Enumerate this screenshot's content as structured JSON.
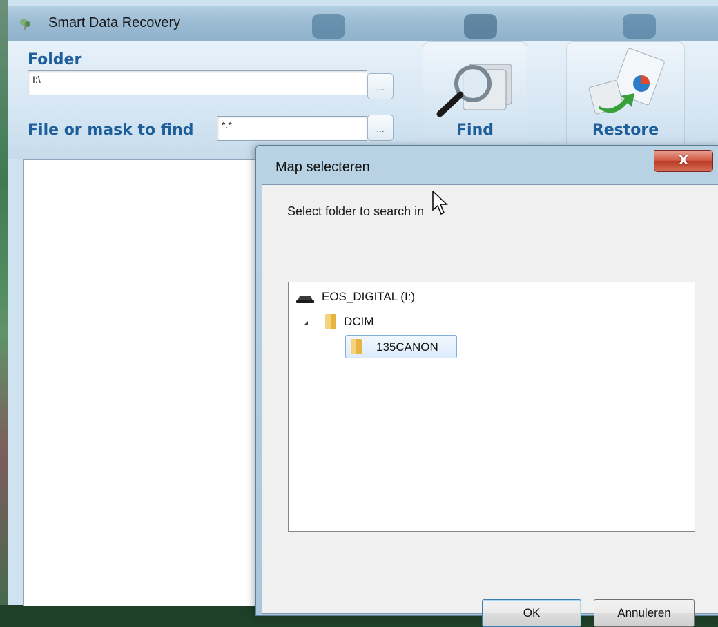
{
  "app": {
    "title": "Smart Data Recovery"
  },
  "toolbar": {
    "folder_label": "Folder",
    "folder_value": "I:\\",
    "mask_label": "File or mask to find",
    "mask_value": "*.*",
    "browse_label": "...",
    "find_label": "Find",
    "restore_label": "Restore"
  },
  "dialog": {
    "title": "Map selecteren",
    "close_label": "X",
    "prompt": "Select folder to search in",
    "tree": [
      {
        "label": "EOS_DIGITAL (I:)",
        "icon": "drive-icon",
        "level": 0
      },
      {
        "label": "DCIM",
        "icon": "folder-icon",
        "level": 1,
        "expanded": true
      },
      {
        "label": "135CANON",
        "icon": "folder-icon",
        "level": 2,
        "selected": true
      }
    ],
    "ok_label": "OK",
    "cancel_label": "Annuleren"
  },
  "colors": {
    "accent_text": "#1d5e9a",
    "close_red": "#c8452e",
    "selection": "#dcebfc"
  }
}
